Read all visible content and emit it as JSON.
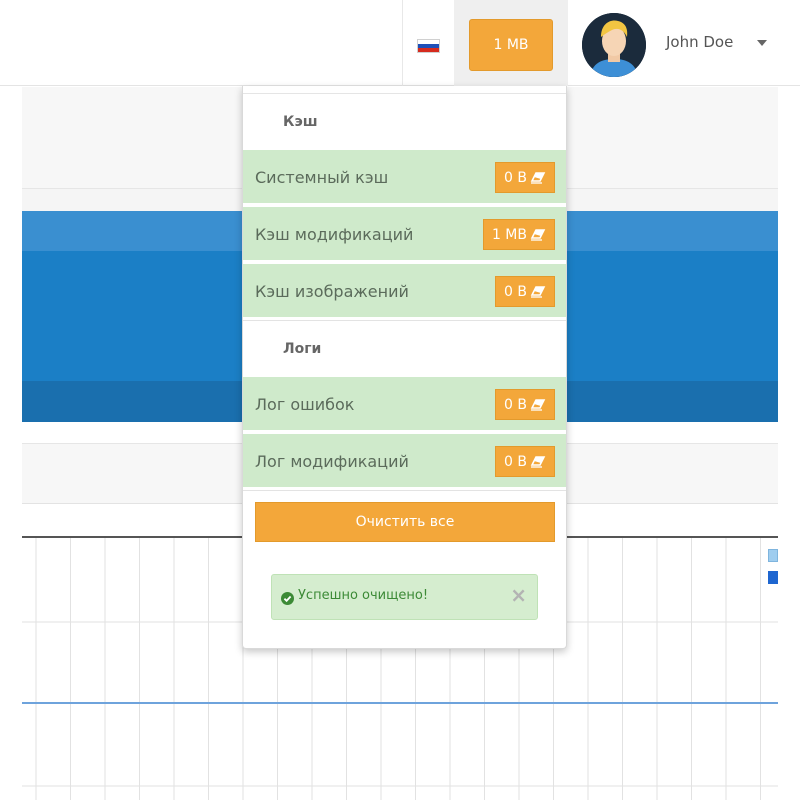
{
  "navbar": {
    "language_flag": "russian-flag-icon",
    "cache_total": "1 MB",
    "user": {
      "name": "John Doe",
      "avatar": "avatar-icon"
    }
  },
  "cache_dropdown": {
    "cache_section_title": "Кэш",
    "cache_items": [
      {
        "label": "Системный кэш",
        "size": "0 B"
      },
      {
        "label": "Кэш модификаций",
        "size": "1 MB"
      },
      {
        "label": "Кэш изображений",
        "size": "0 B"
      }
    ],
    "logs_section_title": "Логи",
    "log_items": [
      {
        "label": "Лог ошибок",
        "size": "0 B"
      },
      {
        "label": "Лог модификаций",
        "size": "0 B"
      }
    ],
    "clear_all_label": "Очистить все",
    "success_message": "Успешно очищено!",
    "close_symbol": "×",
    "badge_icon": "eraser-icon"
  },
  "colors": {
    "accent_orange": "#f3a73a",
    "item_green": "#cfeacb",
    "success_text": "#3c8a36",
    "header_blue": "#1b7fc6"
  }
}
